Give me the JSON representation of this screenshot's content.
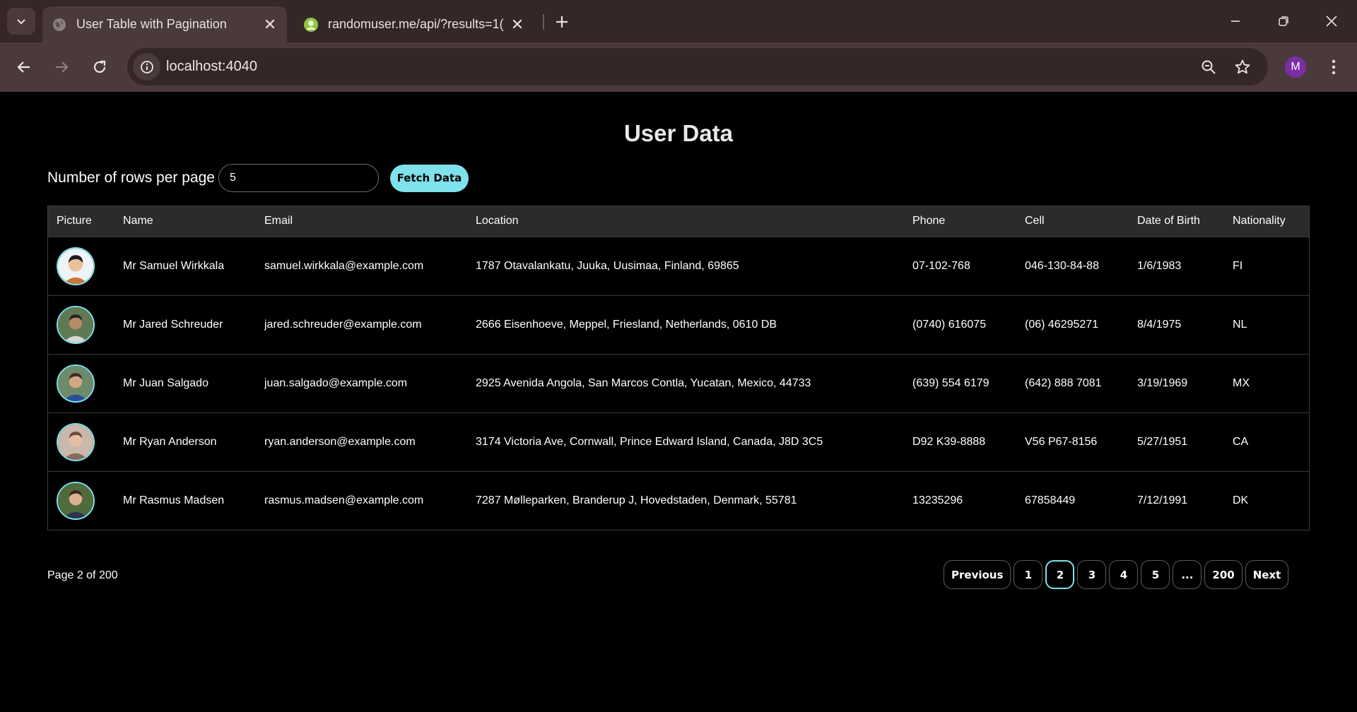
{
  "browser": {
    "tabs": [
      {
        "title": "User Table with Pagination",
        "active": true,
        "icon": "globe-icon"
      },
      {
        "title": "randomuser.me/api/?results=1(",
        "active": false,
        "icon": "randomuser-icon"
      }
    ],
    "url": "localhost:4040",
    "profile_initial": "M"
  },
  "page": {
    "title": "User Data",
    "rows_label": "Number of rows per page",
    "rows_value": "5",
    "fetch_label": "Fetch Data"
  },
  "table": {
    "headers": [
      "Picture",
      "Name",
      "Email",
      "Location",
      "Phone",
      "Cell",
      "Date of Birth",
      "Nationality"
    ],
    "rows": [
      {
        "name": "Mr Samuel Wirkkala",
        "email": "samuel.wirkkala@example.com",
        "location": "1787 Otavalankatu, Juuka, Uusimaa, Finland, 69865",
        "phone": "07-102-768",
        "cell": "046-130-84-88",
        "dob": "1/6/1983",
        "nat": "FI"
      },
      {
        "name": "Mr Jared Schreuder",
        "email": "jared.schreuder@example.com",
        "location": "2666 Eisenhoeve, Meppel, Friesland, Netherlands, 0610 DB",
        "phone": "(0740) 616075",
        "cell": "(06) 46295271",
        "dob": "8/4/1975",
        "nat": "NL"
      },
      {
        "name": "Mr Juan Salgado",
        "email": "juan.salgado@example.com",
        "location": "2925 Avenida Angola, San Marcos Contla, Yucatan, Mexico, 44733",
        "phone": "(639) 554 6179",
        "cell": "(642) 888 7081",
        "dob": "3/19/1969",
        "nat": "MX"
      },
      {
        "name": "Mr Ryan Anderson",
        "email": "ryan.anderson@example.com",
        "location": "3174 Victoria Ave, Cornwall, Prince Edward Island, Canada, J8D 3C5",
        "phone": "D92 K39-8888",
        "cell": "V56 P67-8156",
        "dob": "5/27/1951",
        "nat": "CA"
      },
      {
        "name": "Mr Rasmus Madsen",
        "email": "rasmus.madsen@example.com",
        "location": "7287 Mølleparken, Branderup J, Hovedstaden, Denmark, 55781",
        "phone": "13235296",
        "cell": "67858449",
        "dob": "7/12/1991",
        "nat": "DK"
      }
    ]
  },
  "pagination": {
    "info": "Page 2 of 200",
    "buttons": [
      "Previous",
      "1",
      "2",
      "3",
      "4",
      "5",
      "...",
      "200",
      "Next"
    ],
    "active": "2"
  },
  "colors": {
    "accent": "#7fe1ec",
    "chrome_dark": "#352628",
    "chrome_light": "#4a3a3c"
  }
}
